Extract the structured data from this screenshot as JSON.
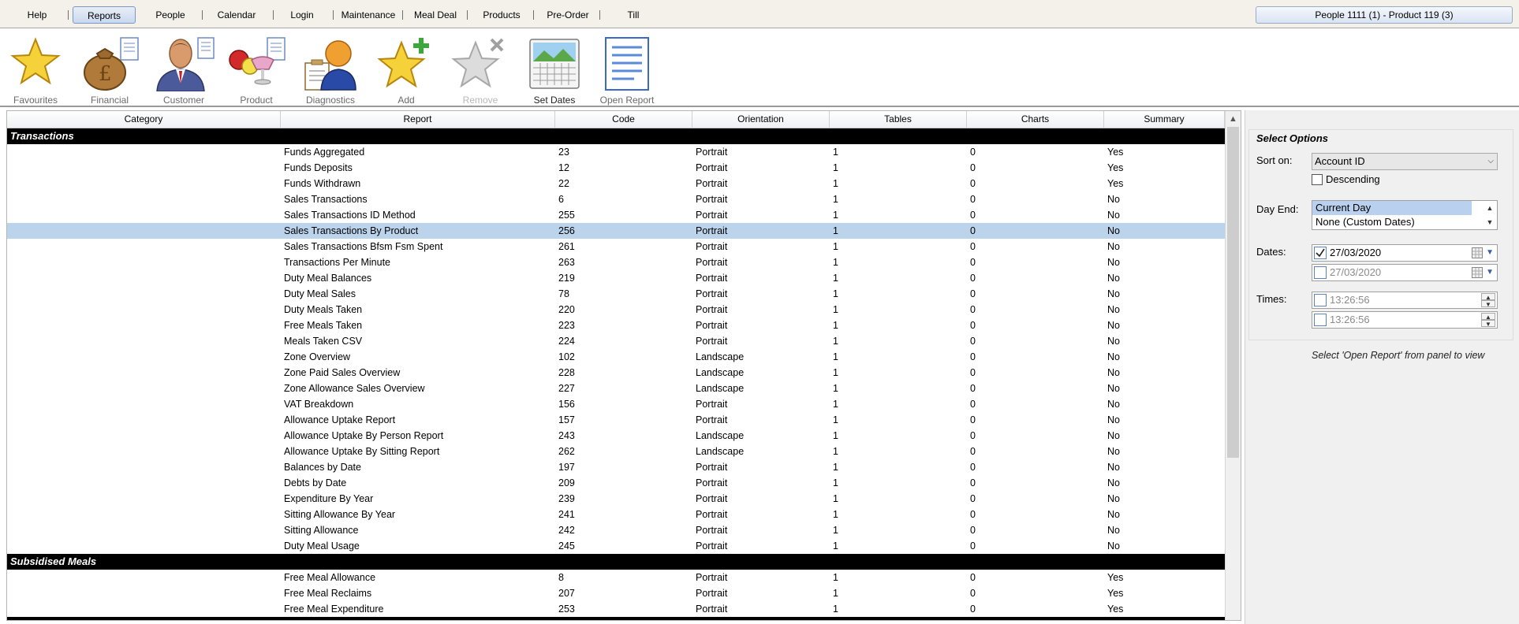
{
  "menu": {
    "items": [
      {
        "label": "Help"
      },
      {
        "label": "Reports",
        "active": true
      },
      {
        "label": "People"
      },
      {
        "label": "Calendar"
      },
      {
        "label": "Login"
      },
      {
        "label": "Maintenance"
      },
      {
        "label": "Meal Deal"
      },
      {
        "label": "Products"
      },
      {
        "label": "Pre-Order"
      },
      {
        "label": "Till"
      }
    ],
    "status": "People 1111 (1)  -  Product 119 (3)"
  },
  "toolbar": {
    "items": [
      {
        "label": "Favourites",
        "icon": "star-icon"
      },
      {
        "label": "Financial",
        "icon": "money-bag-icon"
      },
      {
        "label": "Customer",
        "icon": "customer-icon"
      },
      {
        "label": "Product",
        "icon": "product-icon"
      },
      {
        "label": "Diagnostics",
        "icon": "diagnostics-icon"
      },
      {
        "label": "Add",
        "icon": "add-star-icon"
      },
      {
        "label": "Remove",
        "icon": "remove-star-icon",
        "disabled": true
      },
      {
        "label": "Set Dates",
        "icon": "calendar-icon"
      },
      {
        "label": "Open Report",
        "icon": "document-icon"
      }
    ]
  },
  "grid": {
    "columns": [
      "Category",
      "Report",
      "Code",
      "Orientation",
      "Tables",
      "Charts",
      "Summary"
    ],
    "groups": [
      {
        "name": "Transactions",
        "rows": [
          [
            "Funds Aggregated",
            "23",
            "Portrait",
            "1",
            "0",
            "Yes"
          ],
          [
            "Funds Deposits",
            "12",
            "Portrait",
            "1",
            "0",
            "Yes"
          ],
          [
            "Funds Withdrawn",
            "22",
            "Portrait",
            "1",
            "0",
            "Yes"
          ],
          [
            "Sales Transactions",
            "6",
            "Portrait",
            "1",
            "0",
            "No"
          ],
          [
            "Sales Transactions ID Method",
            "255",
            "Portrait",
            "1",
            "0",
            "No"
          ],
          [
            "Sales Transactions By Product",
            "256",
            "Portrait",
            "1",
            "0",
            "No"
          ],
          [
            "Sales Transactions Bfsm Fsm Spent",
            "261",
            "Portrait",
            "1",
            "0",
            "No"
          ],
          [
            "Transactions Per Minute",
            "263",
            "Portrait",
            "1",
            "0",
            "No"
          ],
          [
            "Duty Meal Balances",
            "219",
            "Portrait",
            "1",
            "0",
            "No"
          ],
          [
            "Duty Meal Sales",
            "78",
            "Portrait",
            "1",
            "0",
            "No"
          ],
          [
            "Duty Meals Taken",
            "220",
            "Portrait",
            "1",
            "0",
            "No"
          ],
          [
            "Free Meals Taken",
            "223",
            "Portrait",
            "1",
            "0",
            "No"
          ],
          [
            "Meals Taken CSV",
            "224",
            "Portrait",
            "1",
            "0",
            "No"
          ],
          [
            "Zone Overview",
            "102",
            "Landscape",
            "1",
            "0",
            "No"
          ],
          [
            "Zone Paid Sales Overview",
            "228",
            "Landscape",
            "1",
            "0",
            "No"
          ],
          [
            "Zone Allowance Sales Overview",
            "227",
            "Landscape",
            "1",
            "0",
            "No"
          ],
          [
            "VAT Breakdown",
            "156",
            "Portrait",
            "1",
            "0",
            "No"
          ],
          [
            "Allowance Uptake Report",
            "157",
            "Portrait",
            "1",
            "0",
            "No"
          ],
          [
            "Allowance Uptake By Person Report",
            "243",
            "Landscape",
            "1",
            "0",
            "No"
          ],
          [
            "Allowance Uptake By Sitting Report",
            "262",
            "Landscape",
            "1",
            "0",
            "No"
          ],
          [
            "Balances by Date",
            "197",
            "Portrait",
            "1",
            "0",
            "No"
          ],
          [
            "Debts by Date",
            "209",
            "Portrait",
            "1",
            "0",
            "No"
          ],
          [
            "Expenditure By Year",
            "239",
            "Portrait",
            "1",
            "0",
            "No"
          ],
          [
            "Sitting Allowance By Year",
            "241",
            "Portrait",
            "1",
            "0",
            "No"
          ],
          [
            "Sitting Allowance",
            "242",
            "Portrait",
            "1",
            "0",
            "No"
          ],
          [
            "Duty Meal Usage",
            "245",
            "Portrait",
            "1",
            "0",
            "No"
          ]
        ]
      },
      {
        "name": "Subsidised Meals",
        "rows": [
          [
            "Free Meal Allowance",
            "8",
            "Portrait",
            "1",
            "0",
            "Yes"
          ],
          [
            "Free Meal Reclaims",
            "207",
            "Portrait",
            "1",
            "0",
            "Yes"
          ],
          [
            "Free Meal Expenditure",
            "253",
            "Portrait",
            "1",
            "0",
            "Yes"
          ]
        ]
      },
      {
        "name": "",
        "rows": []
      }
    ],
    "selected_report": "Sales Transactions By Product"
  },
  "options": {
    "title": "Select Options",
    "sort_label": "Sort on:",
    "sort_value": "Account ID",
    "descending_label": "Descending",
    "descending_checked": false,
    "dayend_label": "Day End:",
    "dayend_options": [
      "Current Day",
      "None (Custom Dates)"
    ],
    "dayend_selected": "Current Day",
    "dates_label": "Dates:",
    "date_from": "27/03/2020",
    "date_from_checked": true,
    "date_to": "27/03/2020",
    "date_to_checked": false,
    "times_label": "Times:",
    "time_from": "13:26:56",
    "time_to": "13:26:56",
    "hint": "Select 'Open Report' from panel to view"
  }
}
